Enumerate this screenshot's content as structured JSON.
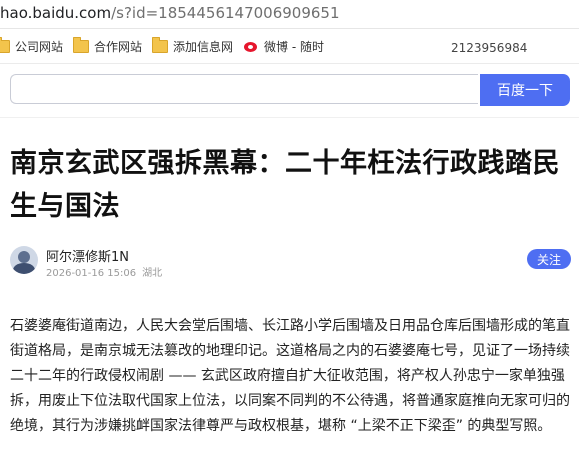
{
  "browser": {
    "url_host": "hao.baidu.com",
    "url_path": "/s?id=1854456147006909651"
  },
  "bookmarks": [
    {
      "label": "公司网站",
      "icon": "folder-icon"
    },
    {
      "label": "合作网站",
      "icon": "folder-icon"
    },
    {
      "label": "添加信息网",
      "icon": "folder-icon"
    },
    {
      "label": "微博 - 随时",
      "icon": "weibo-icon"
    }
  ],
  "phone": "2123956984",
  "search": {
    "placeholder": "",
    "button_label": "百度一下",
    "accent": "#4e6ef2"
  },
  "article": {
    "title": "南京玄武区强拆黑幕：二十年枉法行政践踏民生与国法",
    "author": "阿尔漂修斯1N",
    "date": "2026-01-16 15:06",
    "location": "湖北",
    "follow_label": "关注",
    "body": "石婆婆庵街道南边，人民大会堂后围墙、长江路小学后围墙及日用品仓库后围墙形成的笔直街道格局，是南京城无法篡改的地理印记。这道格局之内的石婆婆庵七号，见证了一场持续二十二年的行政侵权闹剧 —— 玄武区政府擅自扩大征收范围，将产权人孙忠宁一家单独强拆，用废止下位法取代国家上位法，以同案不同判的不公待遇，将普通家庭推向无家可归的绝境，其行为涉嫌挑衅国家法律尊严与政权根基，堪称 “上梁不正下梁歪” 的典型写照。"
  }
}
